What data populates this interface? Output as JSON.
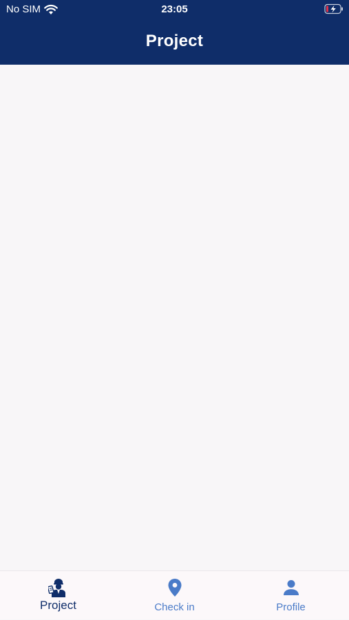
{
  "status_bar": {
    "carrier": "No SIM",
    "time": "23:05",
    "wifi_icon": "wifi-icon",
    "battery_icon": "battery-charging-icon"
  },
  "header": {
    "title": "Project",
    "background_color": "#0f2d69",
    "text_color": "#ffffff"
  },
  "content": {
    "background_color": "#f8f6f8"
  },
  "tabbar": {
    "active_color": "#0f2d69",
    "inactive_color": "#4a7bc8",
    "tabs": [
      {
        "label": "Project",
        "icon": "worker-icon",
        "active": true
      },
      {
        "label": "Check in",
        "icon": "location-pin-icon",
        "active": false
      },
      {
        "label": "Profile",
        "icon": "person-icon",
        "active": false
      }
    ]
  }
}
